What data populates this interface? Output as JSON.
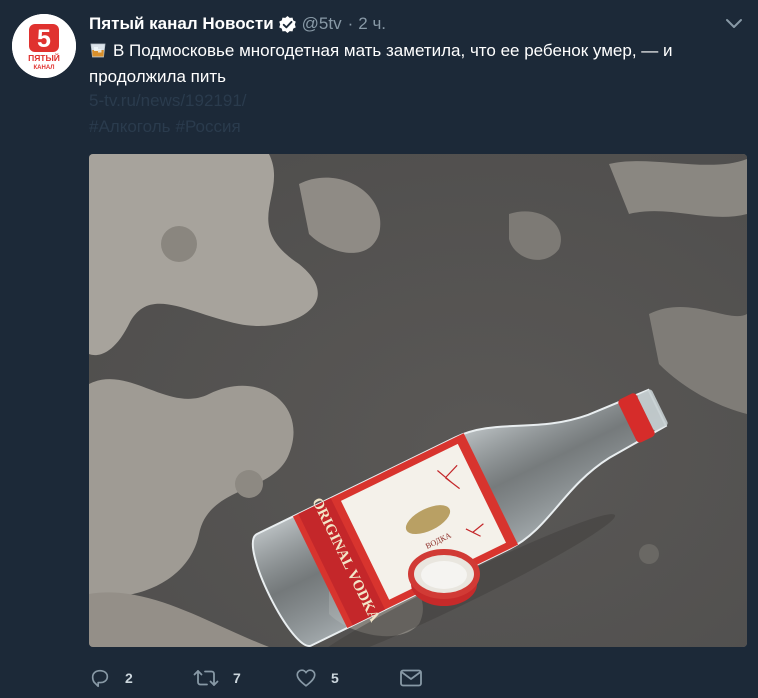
{
  "tweet": {
    "author": {
      "display_name": "Пятый канал Новости",
      "handle": "@5tv",
      "verified": true,
      "avatar_logo": {
        "number": "5",
        "line1": "ПЯТЫЙ",
        "line2": "КАНАЛ"
      }
    },
    "separator": "·",
    "time": "2 ч.",
    "emoji": "tumbler-glass-icon",
    "text": "В Подмосковье многодетная мать заметила, что ее ребенок умер, — и продолжила пить",
    "url": "5-tv.ru/news/192191/",
    "hashtags": [
      "#Алкоголь",
      "#Россия"
    ],
    "media": {
      "bottle_label": "ORIGINAL VODKA",
      "bottle_small_label": "ВОДКА"
    },
    "actions": {
      "replies": "2",
      "retweets": "7",
      "likes": "5"
    }
  },
  "colors": {
    "background": "#1c2938",
    "muted": "#8899a6",
    "link_dim": "#2a3b4d",
    "brand_red": "#e0322f"
  }
}
